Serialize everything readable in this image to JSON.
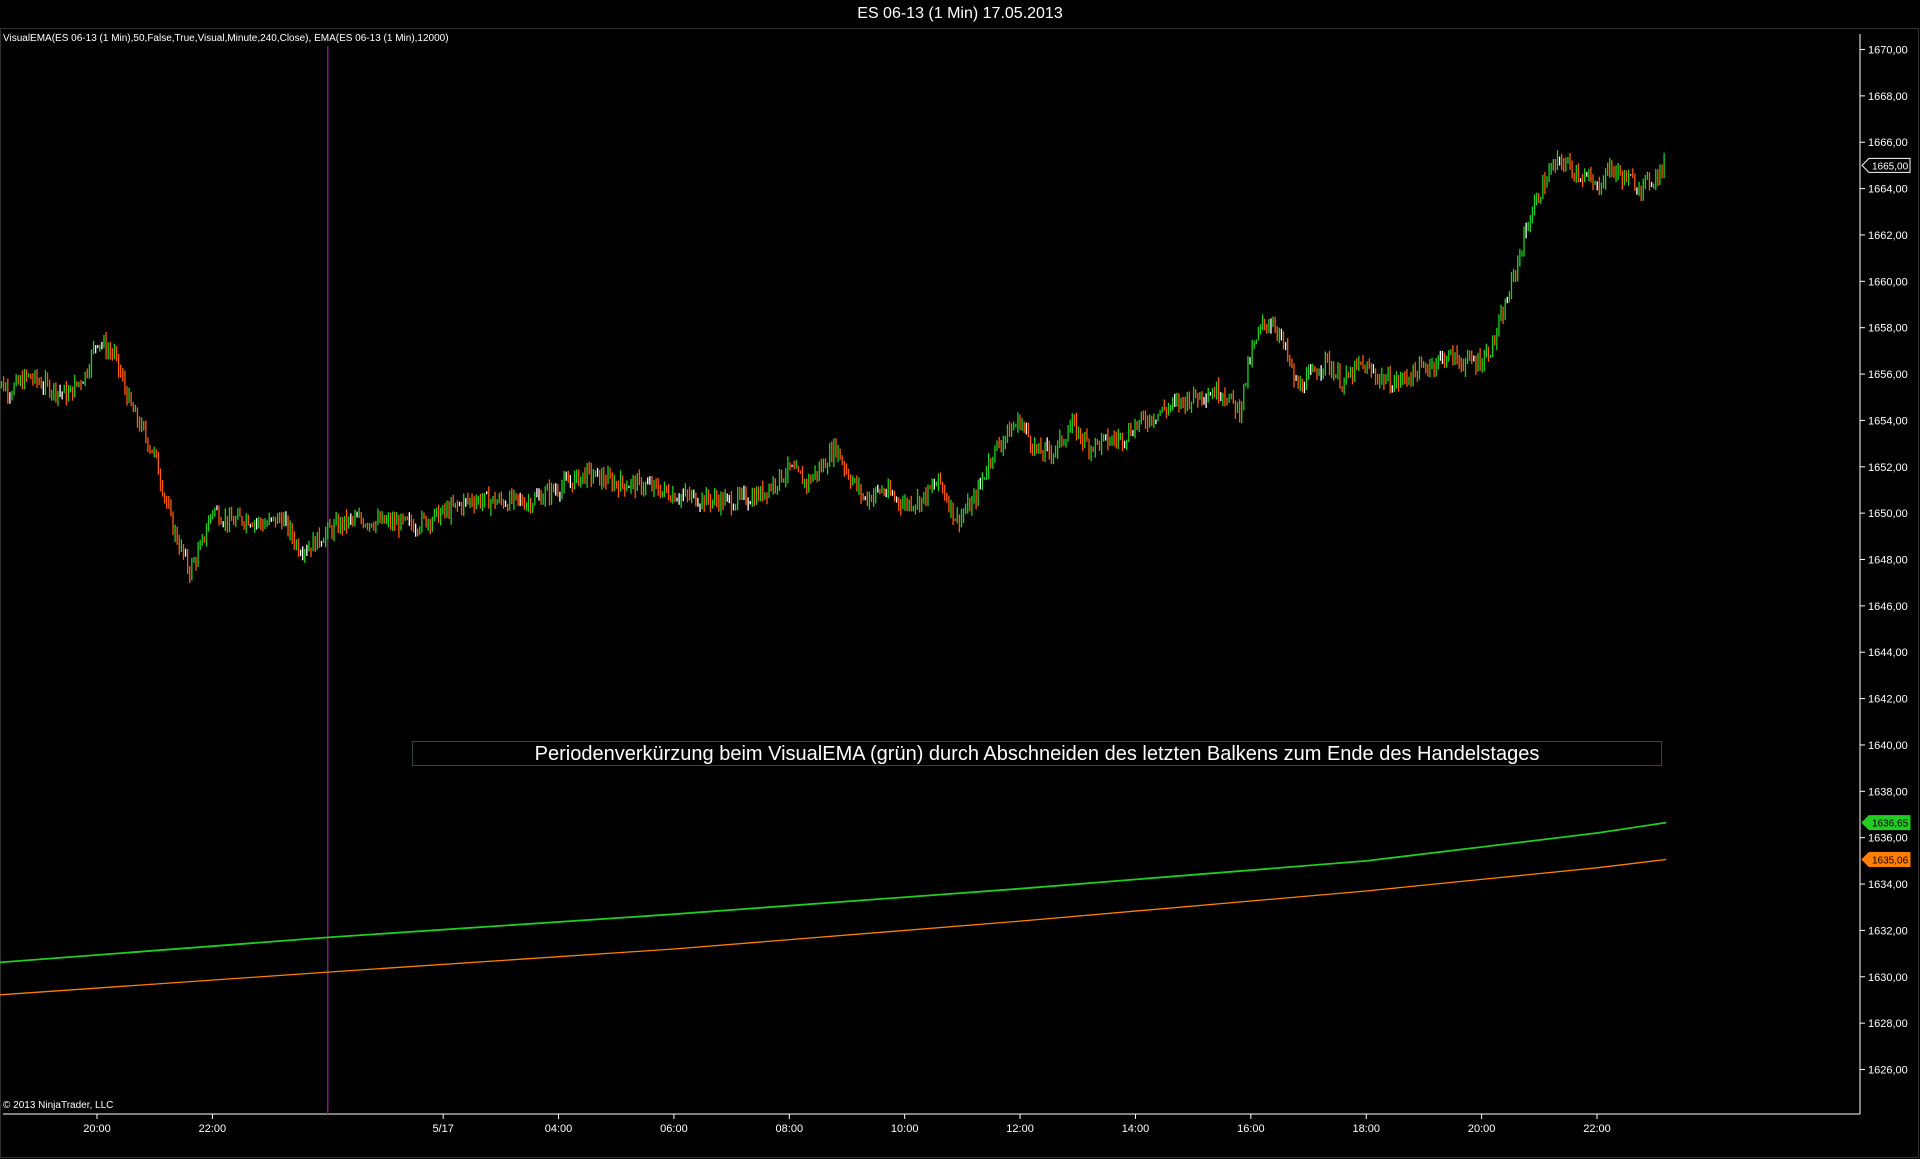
{
  "window": {
    "title": "ES 06-13 (1 Min)  17.05.2013"
  },
  "indicator_label": "VisualEMA(ES 06-13 (1 Min),50,False,True,Visual,Minute,240,Close), EMA(ES 06-13 (1 Min),12000)",
  "copyright": "© 2013 NinjaTrader, LLC",
  "annotation": "Periodenverkürzung beim VisualEMA (grün) durch Abschneiden des letzten Balkens zum Ende des Handelstages",
  "colors": {
    "background": "#000000",
    "bar_up": "#1fd01f",
    "bar_down": "#ff5a0a",
    "bar_flat": "#ffffff",
    "visual_ema": "#22cc22",
    "ema": "#ff8000",
    "session_line": "#7a1f7a",
    "axis": "#ffffff"
  },
  "chart_data": {
    "type": "line",
    "title": "ES 06-13 (1 Min)  17.05.2013",
    "y_axis": {
      "min": 1625,
      "max": 1671,
      "ticks": [
        "1626,00",
        "1628,00",
        "1630,00",
        "1632,00",
        "1634,00",
        "1636,00",
        "1638,00",
        "1640,00",
        "1642,00",
        "1644,00",
        "1646,00",
        "1648,00",
        "1650,00",
        "1652,00",
        "1654,00",
        "1656,00",
        "1658,00",
        "1660,00",
        "1662,00",
        "1664,00",
        "1666,00",
        "1668,00",
        "1670,00"
      ],
      "tick_values": [
        1626,
        1628,
        1630,
        1632,
        1634,
        1636,
        1638,
        1640,
        1642,
        1644,
        1646,
        1648,
        1650,
        1652,
        1654,
        1656,
        1658,
        1660,
        1662,
        1664,
        1666,
        1668,
        1670
      ]
    },
    "x_axis": {
      "ticks": [
        "20:00",
        "22:00",
        "5/17",
        "04:00",
        "06:00",
        "08:00",
        "10:00",
        "12:00",
        "14:00",
        "16:00",
        "18:00",
        "20:00",
        "22:00"
      ],
      "tick_hours": [
        20,
        22,
        26,
        28,
        30,
        32,
        34,
        36,
        38,
        40,
        42,
        44,
        46
      ],
      "start_hour": 18.2,
      "end_hour": 47.2
    },
    "session_break_hour": 24.0,
    "price_path": {
      "hours": [
        18.2,
        18.5,
        18.8,
        19.2,
        19.5,
        19.8,
        20.0,
        20.3,
        20.6,
        21.0,
        21.3,
        21.6,
        21.8,
        22.0,
        22.3,
        22.6,
        22.9,
        23.2,
        23.5,
        23.7,
        24.0,
        24.2,
        24.5,
        25.0,
        25.5,
        26.0,
        26.5,
        27.0,
        27.5,
        28.0,
        28.5,
        29.0,
        29.5,
        30.0,
        30.5,
        31.0,
        31.5,
        32.0,
        32.3,
        32.6,
        32.8,
        33.0,
        33.3,
        33.6,
        34.0,
        34.3,
        34.6,
        34.9,
        35.2,
        35.5,
        35.8,
        36.0,
        36.3,
        36.6,
        36.9,
        37.2,
        37.5,
        37.8,
        38.0,
        38.3,
        38.6,
        38.9,
        39.2,
        39.5,
        39.8,
        40.0,
        40.2,
        40.4,
        40.6,
        40.8,
        41.0,
        41.3,
        41.6,
        41.9,
        42.2,
        42.5,
        42.8,
        43.1,
        43.4,
        43.7,
        44.0,
        44.2,
        44.4,
        44.6,
        44.8,
        45.0,
        45.2,
        45.4,
        45.6,
        45.8,
        46.0,
        46.2,
        46.4,
        46.6,
        46.8,
        47.0,
        47.2
      ],
      "values": [
        1655.8,
        1655.3,
        1655.9,
        1655.4,
        1655.1,
        1656.0,
        1657.5,
        1656.8,
        1654.5,
        1652.5,
        1649.5,
        1647.5,
        1648.5,
        1650.2,
        1649.6,
        1649.8,
        1649.5,
        1649.8,
        1648.5,
        1648.6,
        1649.2,
        1649.5,
        1649.7,
        1649.6,
        1649.5,
        1650.0,
        1650.6,
        1650.5,
        1650.5,
        1651.1,
        1651.7,
        1651.3,
        1651.2,
        1650.8,
        1650.6,
        1650.5,
        1650.8,
        1651.9,
        1651.3,
        1652.1,
        1652.9,
        1651.8,
        1650.6,
        1651.0,
        1650.4,
        1650.6,
        1651.4,
        1649.7,
        1650.5,
        1652.5,
        1653.5,
        1654.0,
        1652.6,
        1652.7,
        1653.8,
        1652.9,
        1653.1,
        1653.3,
        1653.8,
        1654.2,
        1654.6,
        1654.9,
        1655.2,
        1655.3,
        1654.4,
        1656.8,
        1658.1,
        1658.3,
        1657.0,
        1655.4,
        1655.8,
        1656.6,
        1655.6,
        1656.4,
        1655.9,
        1655.6,
        1656.0,
        1656.4,
        1656.8,
        1656.5,
        1656.6,
        1657.3,
        1658.8,
        1660.6,
        1662.5,
        1663.8,
        1664.8,
        1665.2,
        1664.8,
        1664.5,
        1664.0,
        1664.9,
        1664.6,
        1664.3,
        1664.1,
        1664.5,
        1665.0
      ]
    },
    "series": [
      {
        "name": "VisualEMA",
        "hours": [
          18.2,
          24,
          30,
          36,
          42,
          44,
          46,
          47.2
        ],
        "values": [
          1630.6,
          1631.7,
          1632.7,
          1633.8,
          1635.0,
          1635.6,
          1636.2,
          1636.65
        ]
      },
      {
        "name": "EMA",
        "hours": [
          18.2,
          24,
          30,
          36,
          42,
          44,
          46,
          47.2
        ],
        "values": [
          1629.2,
          1630.2,
          1631.2,
          1632.4,
          1633.7,
          1634.2,
          1634.7,
          1635.06
        ]
      }
    ],
    "price_markers": [
      {
        "label": "1665,00",
        "value": 1665.0,
        "color": "#ffffff"
      },
      {
        "label": "1636,65",
        "value": 1636.65,
        "color": "#22cc22"
      },
      {
        "label": "1635,06",
        "value": 1635.06,
        "color": "#ff8000"
      }
    ]
  }
}
